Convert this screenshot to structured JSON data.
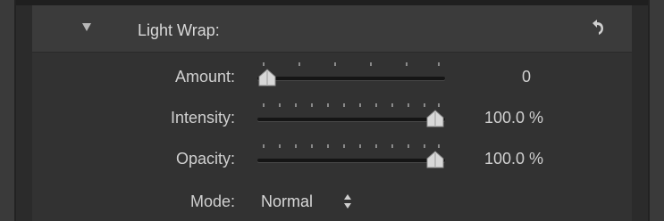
{
  "panel": {
    "title": "Light Wrap",
    "title_suffix": ":"
  },
  "icons": {
    "disclosure": "disclosure-triangle-down-icon",
    "reset": "reset-arrow-icon",
    "mode_stepper": "up-down-arrows-icon"
  },
  "rows": {
    "amount": {
      "label": "Amount:",
      "value": "0",
      "level": 0
    },
    "intensity": {
      "label": "Intensity:",
      "value": "100.0 %",
      "level": 1
    },
    "opacity": {
      "label": "Opacity:",
      "value": "100.0 %",
      "level": 1
    },
    "mode": {
      "label": "Mode:",
      "value": "Normal"
    }
  },
  "colors": {
    "panel_bg": "#323232",
    "header_bg": "#3b3b3b",
    "text": "#d0d0d0",
    "track": "#151515"
  }
}
